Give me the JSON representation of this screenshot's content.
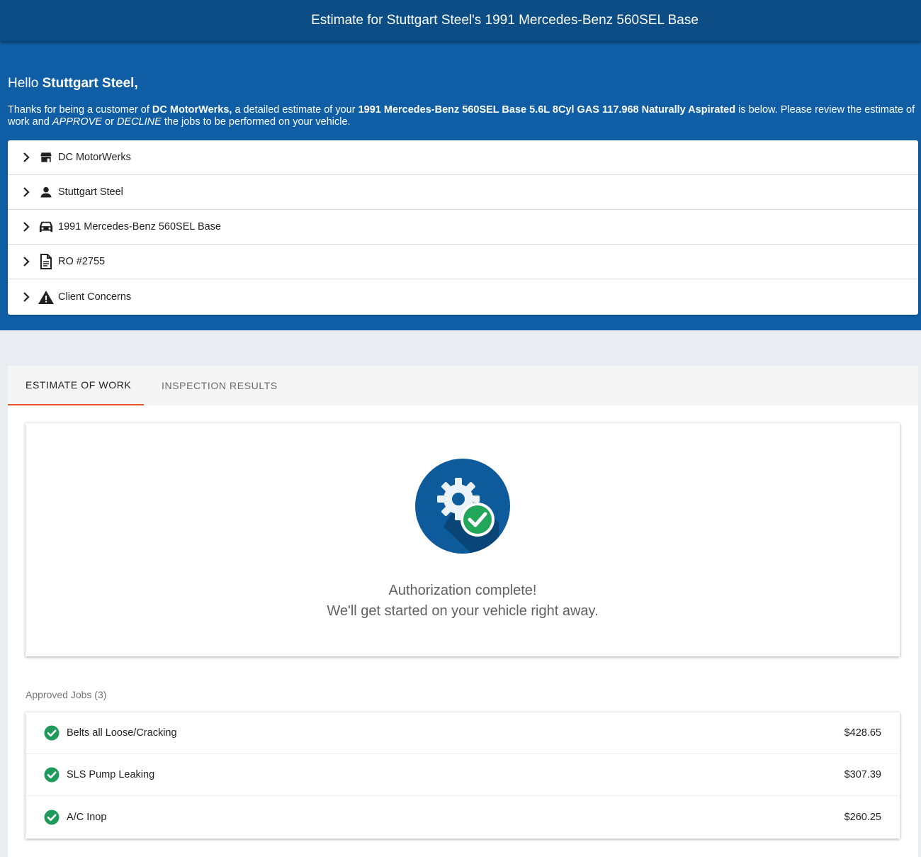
{
  "header": {
    "title": "Estimate for Stuttgart Steel's 1991 Mercedes-Benz 560SEL Base"
  },
  "greeting": {
    "hello": "Hello",
    "name": "Stuttgart Steel,"
  },
  "intro": {
    "p1": "Thanks for being a customer of ",
    "shop": "DC MotorWerks,",
    "p2": " a detailed estimate of your ",
    "vehicle": "1991 Mercedes-Benz 560SEL Base 5.6L 8Cyl GAS 117.968 Naturally Aspirated",
    "p3": " is below. Please review the estimate of work and ",
    "approve": "APPROVE",
    "p4": " or ",
    "decline": "DECLINE",
    "p5": " the jobs to be performed on your vehicle."
  },
  "accordion": {
    "items": [
      {
        "label": "DC MotorWerks",
        "icon": "store-icon"
      },
      {
        "label": "Stuttgart Steel",
        "icon": "person-icon"
      },
      {
        "label": "1991 Mercedes-Benz 560SEL Base",
        "icon": "car-icon"
      },
      {
        "label": "RO #2755",
        "icon": "document-icon"
      },
      {
        "label": "Client Concerns",
        "icon": "warning-icon"
      }
    ]
  },
  "tabs": {
    "estimate": "ESTIMATE OF WORK",
    "inspection": "INSPECTION RESULTS",
    "active": "estimate"
  },
  "authorization": {
    "line1": "Authorization complete!",
    "line2": "We'll get started on your vehicle right away.",
    "icon": "gear-check-icon"
  },
  "approved_jobs": {
    "title": "Approved Jobs (3)",
    "jobs": [
      {
        "name": "Belts all Loose/Cracking",
        "price": "$428.65"
      },
      {
        "name": "SLS Pump Leaking",
        "price": "$307.39"
      },
      {
        "name": "A/C Inop",
        "price": "$260.25"
      }
    ]
  },
  "colors": {
    "topbar": "#0b4d84",
    "hero": "#105fa6",
    "tab_indicator": "#e8582a",
    "check_green": "#1e9a5a"
  }
}
